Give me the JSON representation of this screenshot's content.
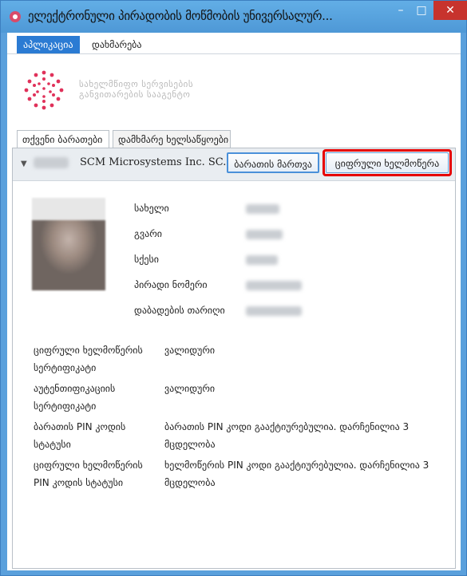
{
  "window": {
    "title": "ელექტრონული პირადობის მოწმობის უნივერსალურ...",
    "minimize": "–",
    "maximize": "□",
    "close": "✕"
  },
  "menu": {
    "application": "აპლიკაცია",
    "help": "დახმარება"
  },
  "logo": {
    "line1": "სახელმწიფო სერვისების",
    "line2": "განვითარების სააგენტო"
  },
  "tabs": {
    "your_cards": "თქვენი ბარათები",
    "helper_tools": "დამხმარე ხელსაწყოები"
  },
  "card": {
    "reader_name": "SCM Microsystems Inc. SC...",
    "manage_button": "ბარათის მართვა",
    "sign_button": "ციფრული ხელმოწერა"
  },
  "person": {
    "first_name_label": "სახელი",
    "last_name_label": "გვარი",
    "sex_label": "სქესი",
    "personal_number_label": "პირადი ნომერი",
    "birth_date_label": "დაბადების თარიღი"
  },
  "status": {
    "sign_cert_label": "ციფრული ხელმოწერის სერტიფიკატი",
    "sign_cert_value": "ვალიდური",
    "auth_cert_label": "აუტენთიფიკაციის სერტიფიკატი",
    "auth_cert_value": "ვალიდური",
    "card_pin_label": "ბარათის PIN კოდის სტატუსი",
    "card_pin_value": "ბარათის PIN კოდი გააქტიურებულია. დარჩენილია 3 მცდელობა",
    "sign_pin_label": "ციფრული ხელმოწერის PIN კოდის სტატუსი",
    "sign_pin_value": "ხელმოწერის PIN კოდი გააქტიურებულია. დარჩენილია 3 მცდელობა"
  }
}
